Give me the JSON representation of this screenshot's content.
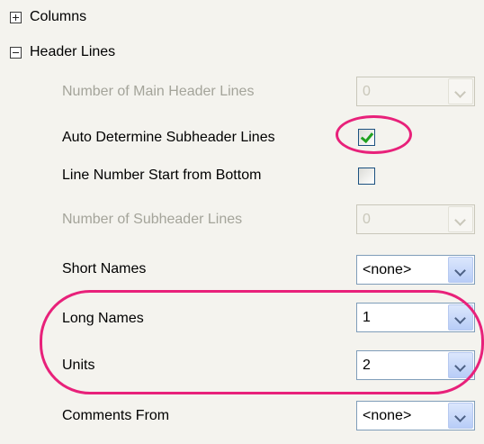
{
  "tree": {
    "columns": "Columns",
    "header_lines": "Header Lines"
  },
  "props": {
    "main_header_lines": {
      "label": "Number of Main Header Lines",
      "value": "0",
      "enabled": false
    },
    "auto_subheader": {
      "label": "Auto Determine Subheader Lines",
      "checked": true
    },
    "line_number_bottom": {
      "label": "Line Number Start from Bottom",
      "checked": false
    },
    "subheader_lines": {
      "label": "Number of Subheader Lines",
      "value": "0",
      "enabled": false
    },
    "short_names": {
      "label": "Short Names",
      "value": "<none>"
    },
    "long_names": {
      "label": "Long Names",
      "value": "1"
    },
    "units": {
      "label": "Units",
      "value": "2"
    },
    "comments_from": {
      "label": "Comments From",
      "value": "<none>"
    }
  },
  "colors": {
    "annotation": "#e8217a",
    "checkmark": "#21a121",
    "panel_bg": "#f4f3ee",
    "disabled_text": "#a4a49a"
  },
  "icons": [
    "expand-plus-icon",
    "collapse-minus-icon",
    "dropdown-arrow-icon",
    "checkmark-icon"
  ]
}
